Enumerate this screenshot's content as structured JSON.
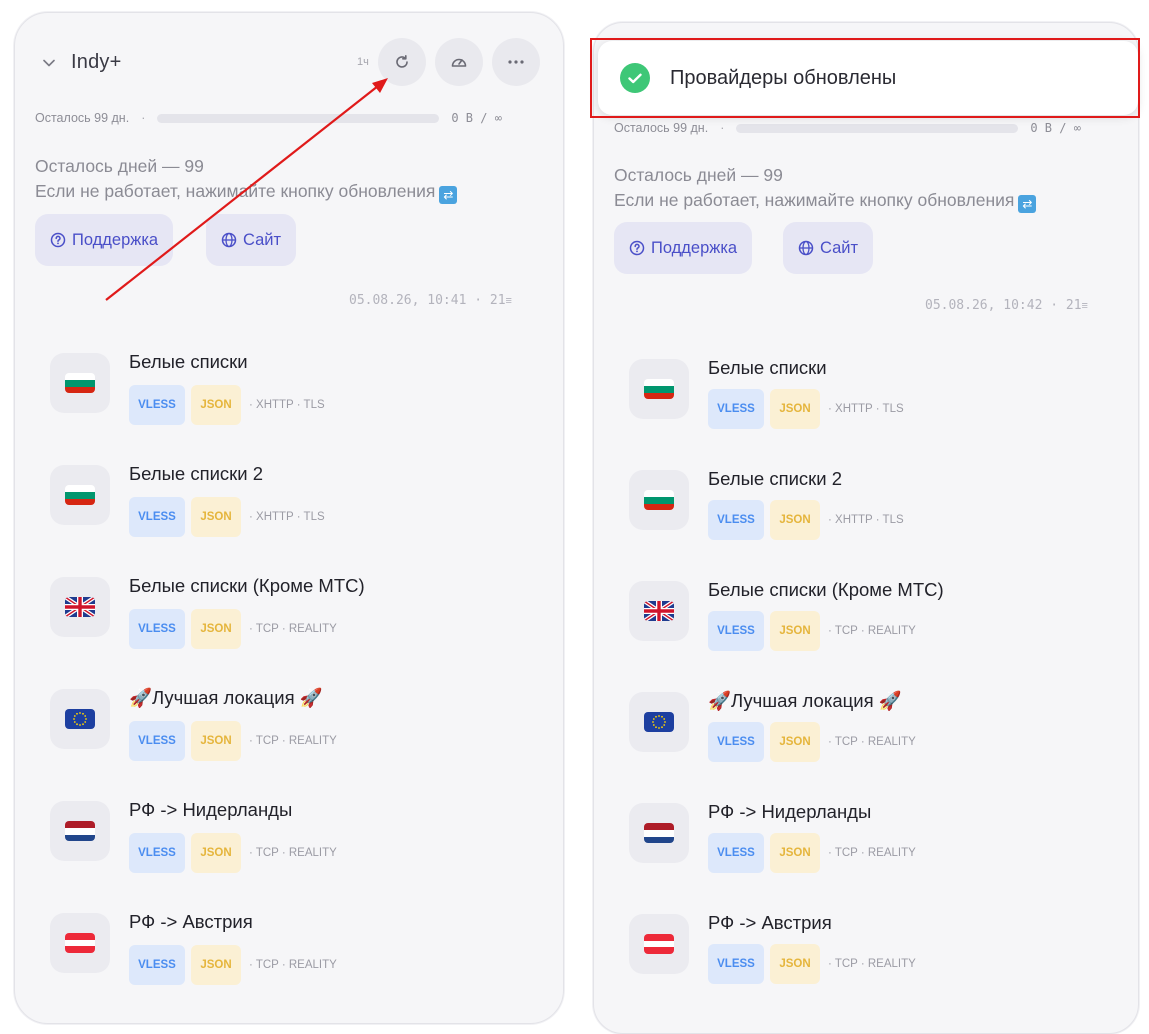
{
  "left": {
    "provider_name": "Indy+",
    "age": "1ч",
    "quota_left": "Осталось 99 дн.",
    "quota_usage": "0 B / ∞",
    "announce_line1": "Осталось дней — 99",
    "announce_line2": "Если не работает, нажимайте кнопку обновления",
    "support_label": "Поддержка",
    "site_label": "Сайт",
    "updated_at": "05.08.26, 10:41",
    "server_count": "21"
  },
  "right": {
    "quota_left": "Осталось 99 дн.",
    "quota_usage": "0 B / ∞",
    "announce_line1": "Осталось дней — 99",
    "announce_line2": "Если не работает, нажимайте кнопку обновления",
    "support_label": "Поддержка",
    "site_label": "Сайт",
    "updated_at": "05.08.26, 10:42",
    "server_count": "21"
  },
  "toast": {
    "text": "Провайдеры обновлены"
  },
  "servers": [
    {
      "name": "Белые списки",
      "flag": "bulgaria",
      "proto": "VLESS",
      "format": "JSON",
      "transport": "XHTTP",
      "security": "TLS"
    },
    {
      "name": "Белые списки 2",
      "flag": "bulgaria",
      "proto": "VLESS",
      "format": "JSON",
      "transport": "XHTTP",
      "security": "TLS"
    },
    {
      "name": "Белые списки (Кроме МТС)",
      "flag": "united-kingdom",
      "proto": "VLESS",
      "format": "JSON",
      "transport": "TCP",
      "security": "REALITY"
    },
    {
      "name": "🚀Лучшая локация 🚀",
      "flag": "european-union",
      "proto": "VLESS",
      "format": "JSON",
      "transport": "TCP",
      "security": "REALITY"
    },
    {
      "name": "РФ -> Нидерланды",
      "flag": "netherlands",
      "proto": "VLESS",
      "format": "JSON",
      "transport": "TCP",
      "security": "REALITY"
    },
    {
      "name": "РФ -> Австрия",
      "flag": "austria",
      "proto": "VLESS",
      "format": "JSON",
      "transport": "TCP",
      "security": "REALITY"
    }
  ],
  "colors": {
    "accent": "#4a4fc8",
    "success": "#3ec777",
    "highlight": "#e01a1a"
  }
}
